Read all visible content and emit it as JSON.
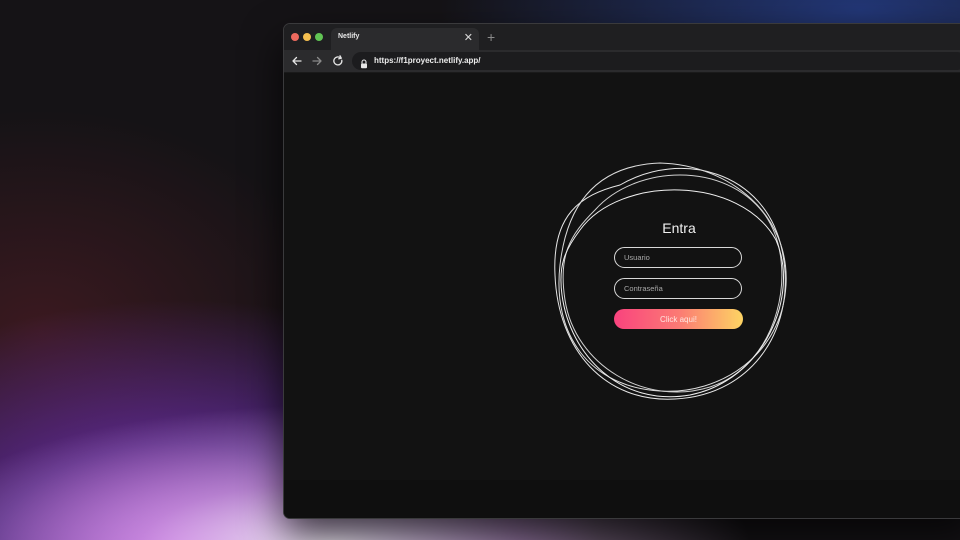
{
  "browser": {
    "tab": {
      "title": "Netlify"
    },
    "address_bar": {
      "url": "https://f1proyect.netlify.app/"
    }
  },
  "login": {
    "title": "Entra",
    "username_placeholder": "Usuario",
    "password_placeholder": "Contraseña",
    "submit_label": "Click aqui!"
  },
  "icons": {
    "close": "close-icon",
    "new_tab": "plus-icon",
    "back": "arrow-left-icon",
    "forward": "arrow-right-icon",
    "reload": "reload-icon",
    "lock": "lock-icon"
  },
  "colors": {
    "traffic_red": "#ed6a5e",
    "traffic_yellow": "#f5bf4f",
    "traffic_green": "#61c454",
    "button_gradient_start": "#f9437e",
    "button_gradient_end": "#fdd463",
    "page_background": "#121212"
  }
}
